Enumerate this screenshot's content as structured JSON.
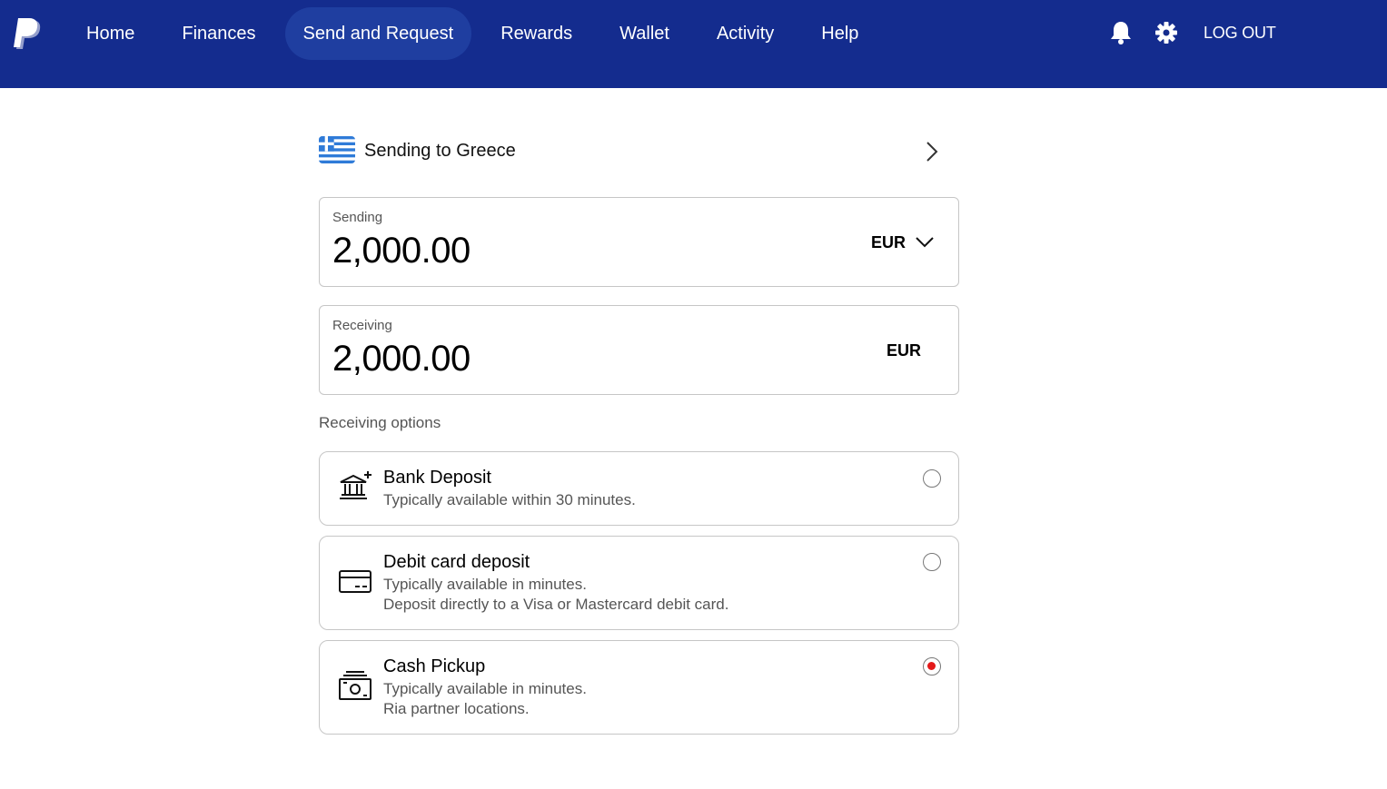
{
  "header": {
    "brand_color": "#142c8e",
    "nav": [
      {
        "label": "Home",
        "active": false
      },
      {
        "label": "Finances",
        "active": false
      },
      {
        "label": "Send and Request",
        "active": true
      },
      {
        "label": "Rewards",
        "active": false
      },
      {
        "label": "Wallet",
        "active": false
      },
      {
        "label": "Activity",
        "active": false
      },
      {
        "label": "Help",
        "active": false
      }
    ],
    "icons": [
      "paypal-logo-icon",
      "bell-icon",
      "gear-icon"
    ],
    "logout_label": "LOG OUT"
  },
  "destination": {
    "flag_icon": "greece-flag-icon",
    "label": "Sending to Greece"
  },
  "sending": {
    "label": "Sending",
    "amount": "2,000.00",
    "currency": "EUR"
  },
  "receiving": {
    "label": "Receiving",
    "amount": "2,000.00",
    "currency": "EUR"
  },
  "receiving_options": {
    "heading": "Receiving options",
    "options": [
      {
        "icon": "bank-icon",
        "title": "Bank Deposit",
        "line1": "Typically available within 30 minutes.",
        "line2": "",
        "selected": false
      },
      {
        "icon": "debit-card-icon",
        "title": "Debit card deposit",
        "line1": "Typically available in minutes.",
        "line2": "Deposit directly to a Visa or Mastercard debit card.",
        "selected": false
      },
      {
        "icon": "cash-icon",
        "title": "Cash Pickup",
        "line1": "Typically available in minutes.",
        "line2": "Ria partner locations.",
        "selected": true
      }
    ],
    "selected_color": "#e41a1a"
  }
}
